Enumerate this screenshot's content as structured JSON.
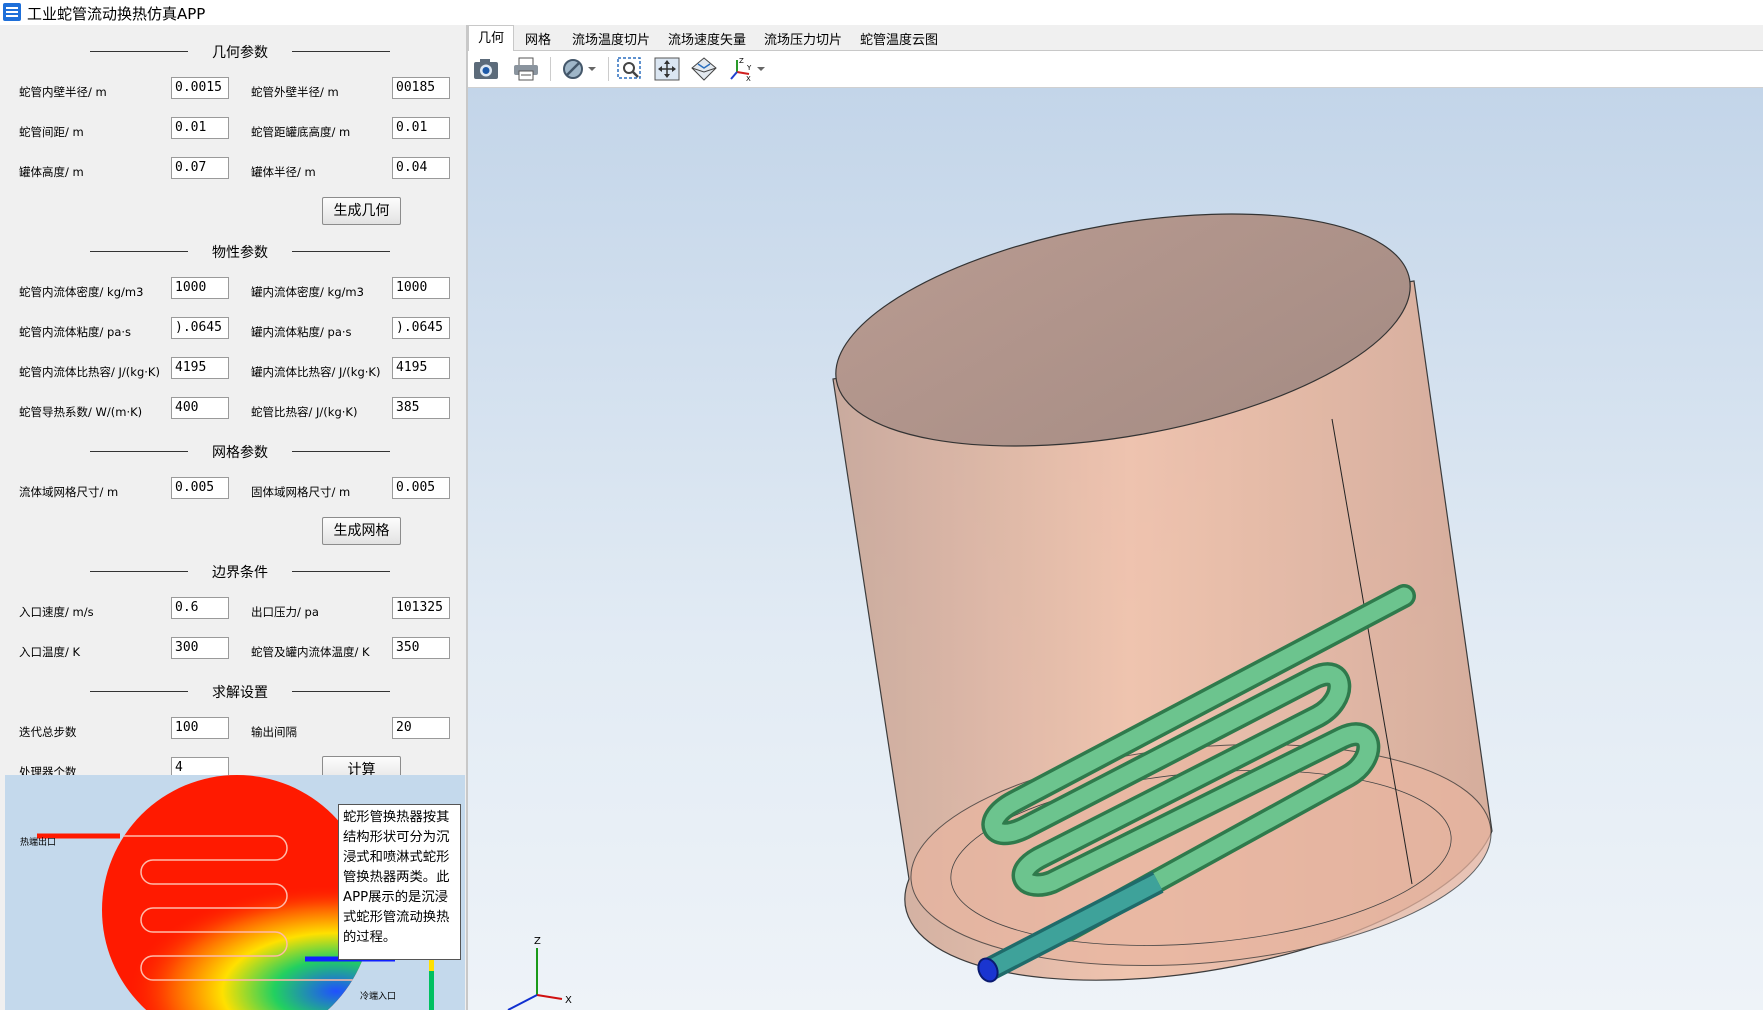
{
  "window": {
    "title": "工业蛇管流动换热仿真APP"
  },
  "sections": {
    "geometry": "几何参数",
    "material": "物性参数",
    "mesh": "网格参数",
    "boundary": "边界条件",
    "solver": "求解设置"
  },
  "geometry": {
    "inner_radius": {
      "label": "蛇管内壁半径/ m",
      "value": "0.0015"
    },
    "outer_radius": {
      "label": "蛇管外壁半径/ m",
      "value": "00185"
    },
    "spacing": {
      "label": "蛇管间距/ m",
      "value": "0.01"
    },
    "bottom_height": {
      "label": "蛇管距罐底高度/ m",
      "value": "0.01"
    },
    "tank_height": {
      "label": "罐体高度/ m",
      "value": "0.07"
    },
    "tank_radius": {
      "label": "罐体半径/ m",
      "value": "0.04"
    },
    "generate_button": "生成几何"
  },
  "material": {
    "tube_density": {
      "label": "蛇管内流体密度/ kg/m3",
      "value": "1000"
    },
    "tank_density": {
      "label": "罐内流体密度/ kg/m3",
      "value": "1000"
    },
    "tube_viscosity": {
      "label": "蛇管内流体粘度/ pa·s",
      "value": ").0645"
    },
    "tank_viscosity": {
      "label": "罐内流体粘度/ pa·s",
      "value": ").0645"
    },
    "tube_cp": {
      "label": "蛇管内流体比热容/ J/(kg·K)",
      "value": "4195"
    },
    "tank_cp": {
      "label": "罐内流体比热容/ J/(kg·K)",
      "value": "4195"
    },
    "tube_k": {
      "label": "蛇管导热系数/ W/(m·K)",
      "value": "400"
    },
    "tube_solid_cp": {
      "label": "蛇管比热容/ J/(kg·K)",
      "value": "385"
    }
  },
  "mesh": {
    "fluid_size": {
      "label": "流体域网格尺寸/ m",
      "value": "0.005"
    },
    "solid_size": {
      "label": "固体域网格尺寸/ m",
      "value": "0.005"
    },
    "generate_button": "生成网格"
  },
  "boundary": {
    "inlet_velocity": {
      "label": "入口速度/ m/s",
      "value": "0.6"
    },
    "outlet_pressure": {
      "label": "出口压力/ pa",
      "value": "101325"
    },
    "inlet_temp": {
      "label": "入口温度/ K",
      "value": "300"
    },
    "tank_temp": {
      "label": "蛇管及罐内流体温度/ K",
      "value": "350"
    }
  },
  "solver": {
    "iterations": {
      "label": "迭代总步数",
      "value": "100"
    },
    "output_interval": {
      "label": "输出间隔",
      "value": "20"
    },
    "processors": {
      "label": "处理器个数",
      "value": "4"
    },
    "compute_button": "计算"
  },
  "preview": {
    "hot_outlet": "热端出口",
    "cold_inlet": "冷端入口",
    "description": "蛇形管换热器按其结构形状可分为沉浸式和喷淋式蛇形管换热器两类。此APP展示的是沉浸式蛇形管流动换热的过程。"
  },
  "tabs": [
    "几何",
    "网格",
    "流场温度切片",
    "流场速度矢量",
    "流场压力切片",
    "蛇管温度云图"
  ],
  "toolbar": {
    "icons": [
      "camera-icon",
      "print-icon",
      "display-mode-icon",
      "zoom-box-icon",
      "fit-all-icon",
      "view-iso-icon",
      "axes-orient-icon"
    ]
  },
  "viewport": {
    "axes": {
      "x": "X",
      "y": "Y",
      "z": "Z"
    }
  },
  "colors": {
    "tank": "#e8b8a0",
    "tube": "#66c088",
    "inlet": "#1a35d0",
    "accent": "#1e6fd9"
  }
}
